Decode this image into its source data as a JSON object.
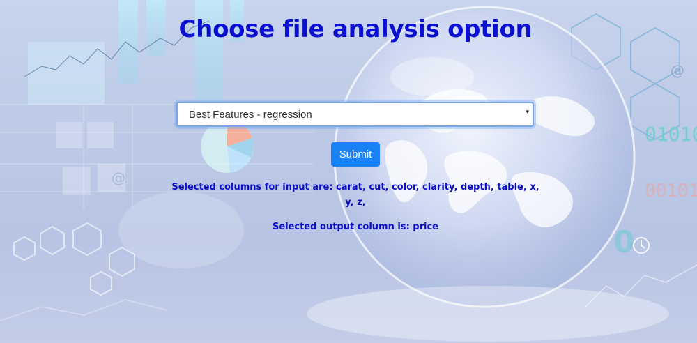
{
  "page": {
    "title": "Choose file analysis option"
  },
  "analysis_select": {
    "selected": "Best Features - regression",
    "caret": "▾"
  },
  "submit": {
    "label": "Submit"
  },
  "info": {
    "input_columns": "Selected columns for input are: carat, cut, color, clarity, depth, table, x, y, z,",
    "output_column": "Selected output column is: price"
  },
  "background": {
    "digits_1": "01010",
    "digits_2": "00101",
    "at_symbol": "@",
    "accent": "#1a82f5",
    "title_color": "#0b0fcf"
  }
}
